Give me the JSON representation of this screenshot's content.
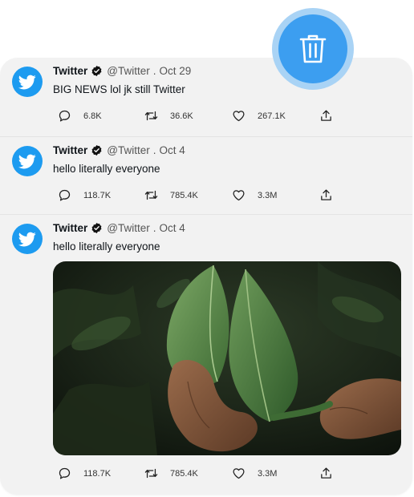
{
  "tweets": [
    {
      "name": "Twitter",
      "handle": "@Twitter",
      "separator": ".",
      "date": "Oct 29",
      "text": "BIG NEWS lol jk still Twitter",
      "replies": "6.8K",
      "retweets": "36.6K",
      "likes": "267.1K"
    },
    {
      "name": "Twitter",
      "handle": "@Twitter",
      "separator": ".",
      "date": "Oct 4",
      "text": "hello literally everyone",
      "replies": "118.7K",
      "retweets": "785.4K",
      "likes": "3.3M"
    },
    {
      "name": "Twitter",
      "handle": "@Twitter",
      "separator": ".",
      "date": "Oct 4",
      "text": "hello literally everyone",
      "replies": "118.7K",
      "retweets": "785.4K",
      "likes": "3.3M",
      "has_image": true
    }
  ],
  "icons": {
    "avatar": "twitter-bird-icon",
    "verified": "verified-badge-icon",
    "reply": "reply-icon",
    "retweet": "retweet-icon",
    "like": "heart-icon",
    "share": "share-icon",
    "fab": "trash-icon"
  },
  "colors": {
    "brand": "#1d9bf0",
    "fab": "#3c9ef0",
    "fab_halo": "#a9d3f5",
    "card_bg": "#f2f2f2"
  }
}
